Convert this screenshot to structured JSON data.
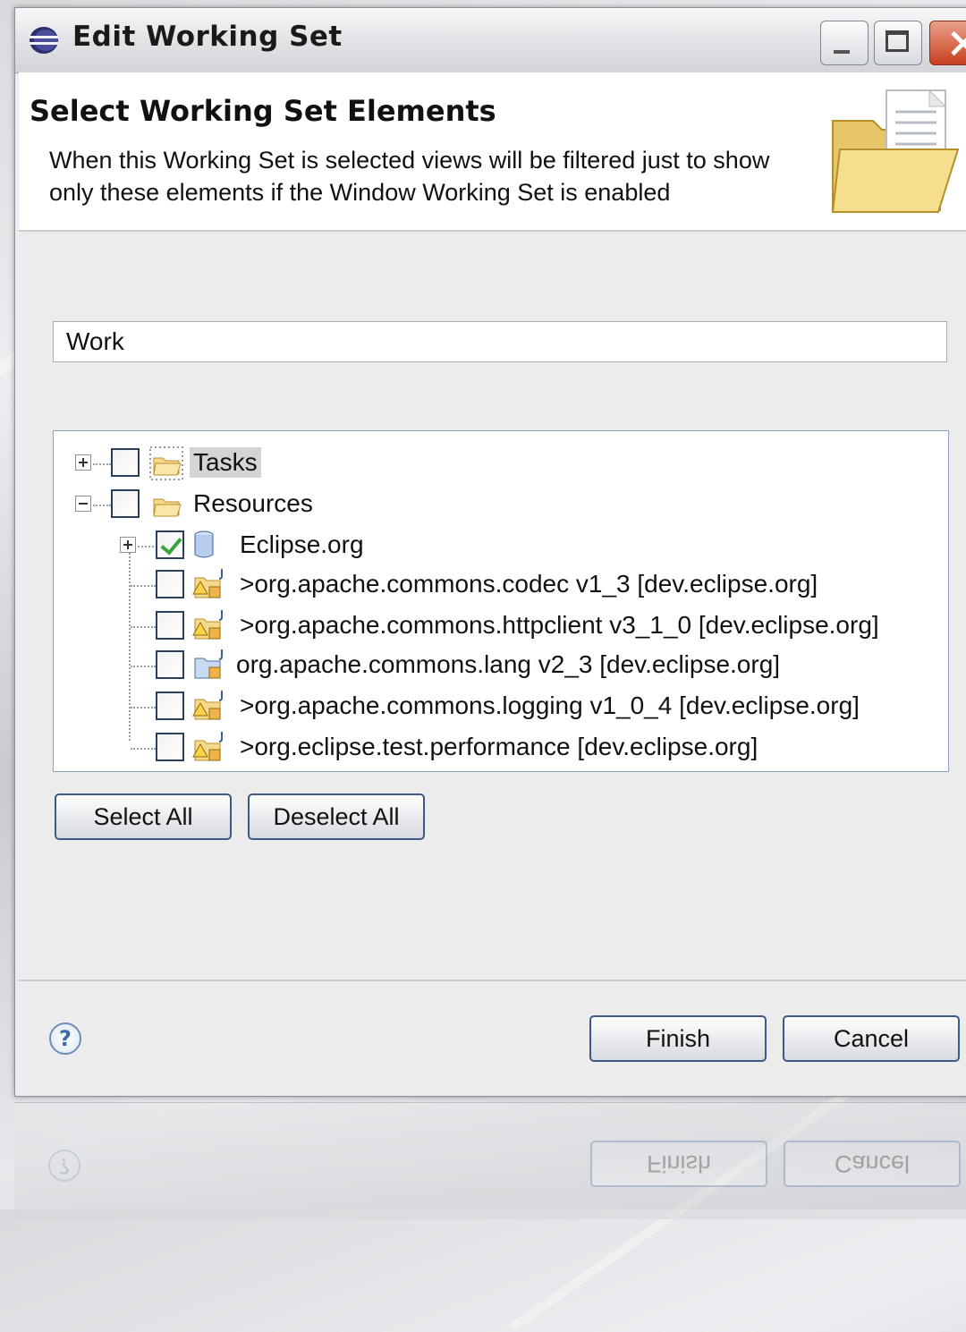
{
  "window": {
    "title": "Edit Working Set",
    "controls": {
      "minimize": "minimize-icon",
      "maximize": "maximize-icon",
      "close": "close-icon"
    }
  },
  "header": {
    "title": "Select Working Set Elements",
    "description": "When this Working Set is selected views will be filtered just to show only these elements if the Window Working Set is enabled"
  },
  "name_field": {
    "value": "Work"
  },
  "tree": {
    "items": [
      {
        "label": "Tasks",
        "expander": "plus",
        "checked": false,
        "selected": true,
        "icon": "folder-icon"
      },
      {
        "label": "Resources",
        "expander": "minus",
        "checked": false,
        "selected": false,
        "icon": "folder-icon"
      },
      {
        "label": "Eclipse.org",
        "expander": "plus",
        "checked": true,
        "selected": false,
        "icon": "repository-icon"
      },
      {
        "label": ">org.apache.commons.codec  v1_3 [dev.eclipse.org]",
        "checked": false,
        "icon": "java-project-warning-icon"
      },
      {
        "label": ">org.apache.commons.httpclient  v3_1_0 [dev.eclipse.org]",
        "checked": false,
        "icon": "java-project-warning-icon"
      },
      {
        "label": "org.apache.commons.lang  v2_3 [dev.eclipse.org]",
        "checked": false,
        "icon": "java-project-icon"
      },
      {
        "label": ">org.apache.commons.logging  v1_0_4 [dev.eclipse.org]",
        "checked": false,
        "icon": "java-project-warning-icon"
      },
      {
        "label": ">org.eclipse.test.performance   [dev.eclipse.org]",
        "checked": false,
        "icon": "java-project-warning-icon"
      }
    ]
  },
  "buttons": {
    "select_all": "Select All",
    "deselect_all": "Deselect All",
    "finish": "Finish",
    "cancel": "Cancel",
    "help": "?"
  },
  "reflection": {
    "finish": "Finish",
    "cancel": "Cancel"
  }
}
